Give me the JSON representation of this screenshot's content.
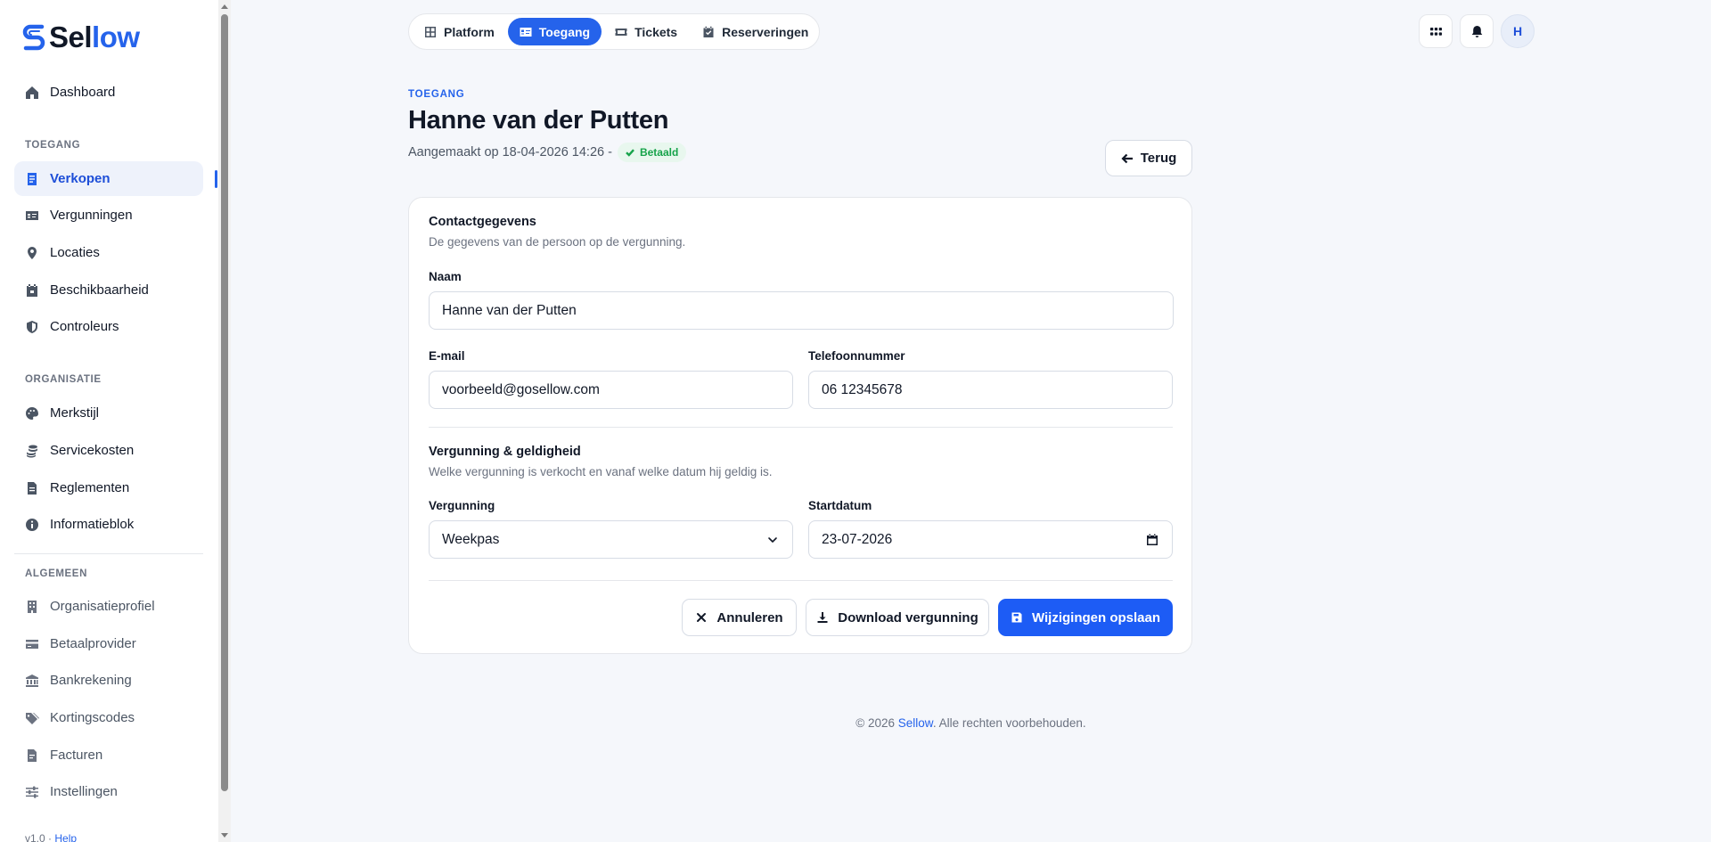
{
  "brand": {
    "name_start": "Sel",
    "name_accent": "low"
  },
  "sidebar": {
    "dashboard": "Dashboard",
    "section_toegang": "TOEGANG",
    "toegang_items": [
      "Verkopen",
      "Vergunningen",
      "Locaties",
      "Beschikbaarheid",
      "Controleurs"
    ],
    "section_organisatie": "ORGANISATIE",
    "organisatie_items": [
      "Merkstijl",
      "Servicekosten",
      "Reglementen",
      "Informatieblok"
    ],
    "section_algemeen": "ALGEMEEN",
    "algemeen_items": [
      "Organisatieprofiel",
      "Betaalprovider",
      "Bankrekening",
      "Kortingscodes",
      "Facturen",
      "Instellingen"
    ],
    "version": "v1.0 ·",
    "help": "Help"
  },
  "topnav": {
    "tabs": [
      "Platform",
      "Toegang",
      "Tickets",
      "Reserveringen"
    ],
    "active": "Toegang"
  },
  "user": {
    "initial": "H"
  },
  "header": {
    "eyebrow": "TOEGANG",
    "title": "Hanne van der Putten",
    "meta": "Aangemaakt op 18-04-2026 14:26 -",
    "status": "Betaald",
    "back": "Terug"
  },
  "contact": {
    "title": "Contactgegevens",
    "subtitle": "De gegevens van de persoon op de vergunning.",
    "name_label": "Naam",
    "name_value": "Hanne van der Putten",
    "email_label": "E-mail",
    "email_value": "voorbeeld@gosellow.com",
    "phone_label": "Telefoonnummer",
    "phone_value": "06 12345678"
  },
  "permit": {
    "title": "Vergunning & geldigheid",
    "subtitle": "Welke vergunning is verkocht en vanaf welke datum hij geldig is.",
    "type_label": "Vergunning",
    "type_value": "Weekpas",
    "start_label": "Startdatum",
    "start_value": "23-07-2026"
  },
  "actions": {
    "cancel": "Annuleren",
    "download": "Download vergunning",
    "save": "Wijzigingen opslaan"
  },
  "footer": {
    "prefix": "© 2026 ",
    "brand": "Sellow",
    "suffix": ". Alle rechten voorbehouden."
  },
  "colors": {
    "accent": "#2563eb",
    "success": "#16a34a"
  }
}
